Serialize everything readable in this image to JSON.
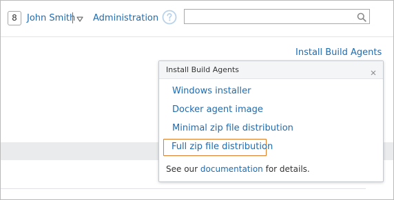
{
  "header": {
    "count_badge": "8",
    "user_name": "John Smith",
    "admin_link": "Administration",
    "search": {
      "value": "",
      "placeholder": ""
    },
    "icons": [
      "chevron-down-icon",
      "help-icon",
      "search-icon"
    ]
  },
  "main": {
    "install_link": "Install Build Agents"
  },
  "popup": {
    "title": "Install Build Agents",
    "close_icon": "close-icon",
    "items": [
      {
        "label": "Windows installer"
      },
      {
        "label": "Docker agent image"
      },
      {
        "label": "Minimal zip file distribution"
      },
      {
        "label": "Full zip file distribution",
        "highlighted": true
      }
    ],
    "footer": {
      "prefix": "See our ",
      "link": "documentation",
      "suffix": " for details."
    }
  },
  "colors": {
    "link": "#1e6bb0",
    "highlight_border": "#e07b2a",
    "band": "#e9ebed",
    "help_icon": "#b9d2ea"
  }
}
